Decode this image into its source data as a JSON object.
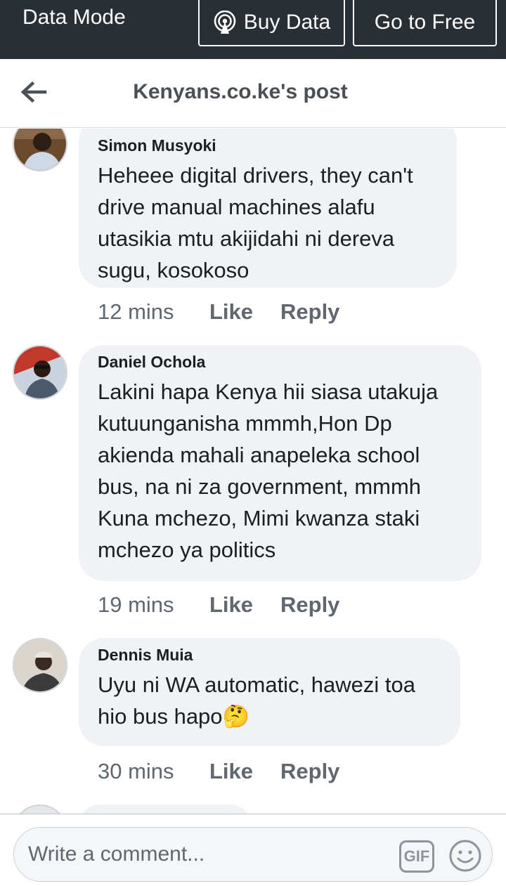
{
  "databar": {
    "mode_label": "Data Mode",
    "buy_label": "Buy Data",
    "free_label": "Go to Free"
  },
  "header": {
    "title": "Kenyans.co.ke's post"
  },
  "comments": [
    {
      "author": "Simon Musyoki",
      "text": "Heheee digital drivers, they can't drive manual machines alafu utasikia mtu akijidahi ni dereva sugu, kosokoso",
      "time": "12 mins",
      "like": "Like",
      "reply": "Reply"
    },
    {
      "author": "Daniel Ochola",
      "text": "Lakini hapa Kenya hii siasa utakuja kutuunganisha mmmh,Hon Dp akienda mahali anapeleka school bus, na ni za government, mmmh Kuna mchezo, Mimi kwanza staki mchezo ya politics",
      "time": "19 mins",
      "like": "Like",
      "reply": "Reply"
    },
    {
      "author": "Dennis Muia",
      "text": "Uyu ni WA automatic, hawezi toa hio bus hapo🤔",
      "time": "30 mins",
      "like": "Like",
      "reply": "Reply"
    }
  ],
  "composer": {
    "placeholder": "Write a comment...",
    "gif_label": "GIF"
  },
  "colors": {
    "databar_bg": "#283036",
    "bubble_bg": "#f0f2f5",
    "meta_text": "#606770"
  },
  "icons": [
    "back-arrow-icon",
    "broadcast-icon",
    "gif-icon",
    "smiley-icon"
  ]
}
